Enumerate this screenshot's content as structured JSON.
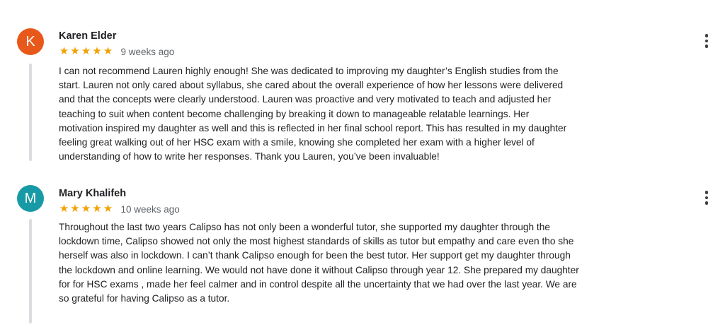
{
  "reviews": [
    {
      "initial": "K",
      "avatar_color": "#e8581a",
      "name": "Karen Elder",
      "rating": 5,
      "star_glyph": "★",
      "time": "9 weeks ago",
      "menu_icon": "more-vert-icon",
      "text_lines": [
        "I can not recommend Lauren highly enough! She was dedicated to improving my daughter’s English studies from the",
        "start. Lauren not only cared about syllabus, she cared about the overall experience of how her lessons were delivered",
        "and that the concepts were clearly understood. Lauren was proactive and very motivated to teach and adjusted her",
        "teaching to suit when content become challenging by breaking it down to manageable relatable learnings. Her",
        "motivation inspired my daughter as well and this is reflected in her final school report. This has resulted in my daughter",
        "feeling great walking out of her HSC exam with a smile, knowing she completed her exam with a higher level of",
        "understanding of how to write her responses. Thank you Lauren, you’ve been invaluable!"
      ]
    },
    {
      "initial": "M",
      "avatar_color": "#179aa6",
      "name": "Mary Khalifeh",
      "rating": 5,
      "star_glyph": "★",
      "time": "10 weeks ago",
      "menu_icon": "more-vert-icon",
      "text_lines": [
        "Throughout the last two years Calipso has not only been a wonderful tutor, she supported my daughter through the",
        "lockdown time, Calipso showed not only the most highest standards of skills as tutor but empathy and care even tho she",
        "herself was also in lockdown. I can’t thank Calipso enough for been the best tutor. Her support get my daughter through",
        "the lockdown and online learning. We would not have done it without Calipso through year 12. She prepared my daughter",
        "for for HSC exams , made her feel calmer and in control despite all the uncertainty that we had over the last year. We are",
        "so grateful for having Calipso as a tutor."
      ]
    }
  ],
  "colors": {
    "star": "#f4a100",
    "thread_line": "#dadce0",
    "meta_text": "#5f6368"
  }
}
